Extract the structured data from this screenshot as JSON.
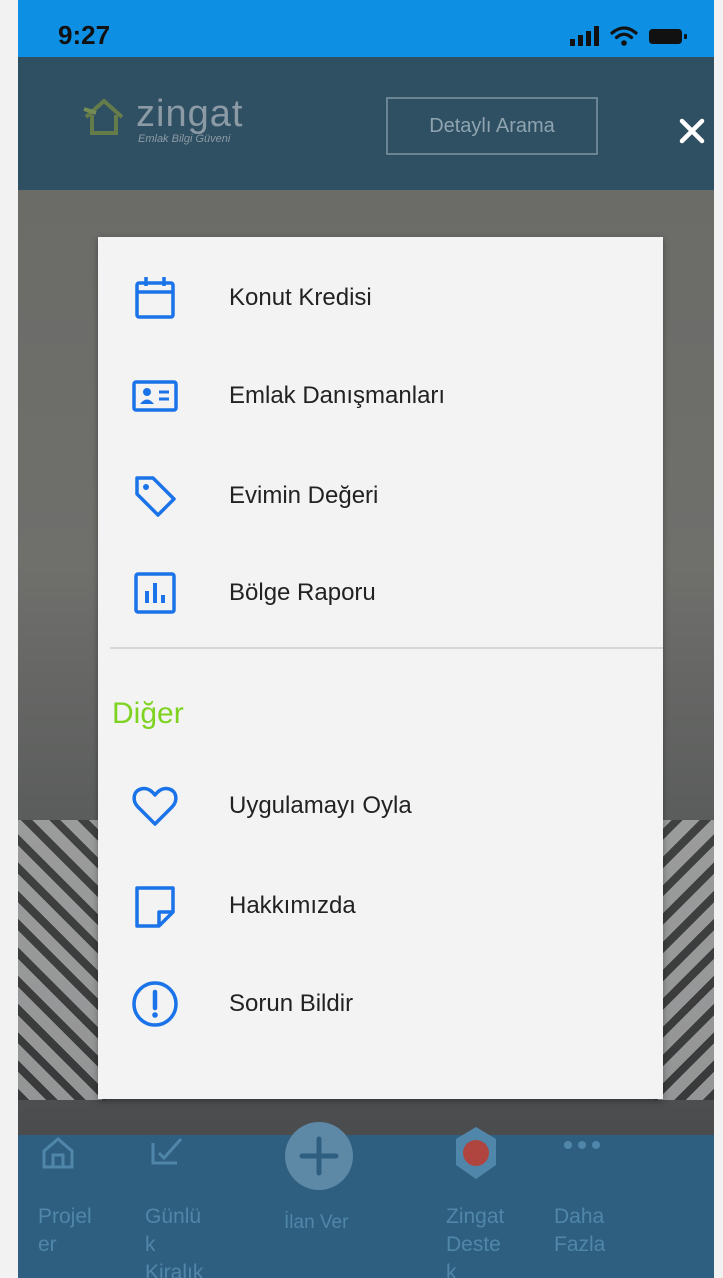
{
  "status_bar": {
    "time": "9:27"
  },
  "header": {
    "logo_text": "zingat",
    "logo_tagline": "Emlak Bilgi Güveni",
    "search_button": "Detaylı Arama"
  },
  "menu": {
    "items": [
      {
        "label": "Konut Kredisi",
        "icon": "calendar-icon"
      },
      {
        "label": "Emlak Danışmanları",
        "icon": "id-card-icon"
      },
      {
        "label": "Evimin Değeri",
        "icon": "tag-icon"
      },
      {
        "label": "Bölge Raporu",
        "icon": "bar-chart-icon"
      }
    ],
    "section_title": "Diğer",
    "other_items": [
      {
        "label": "Uygulamayı Oyla",
        "icon": "heart-icon"
      },
      {
        "label": "Hakkımızda",
        "icon": "note-icon"
      },
      {
        "label": "Sorun Bildir",
        "icon": "alert-circle-icon"
      }
    ]
  },
  "tab_bar": {
    "tabs": [
      {
        "label_lines": [
          "Projel",
          "er"
        ],
        "icon": "home-icon"
      },
      {
        "label_lines": [
          "Günlü",
          "k",
          "Kiralık"
        ],
        "icon": "calendar-check-icon"
      },
      {
        "label_lines": [
          "İlan Ver"
        ],
        "icon": "plus-icon"
      },
      {
        "label_lines": [
          "Zingat",
          "Deste",
          "k"
        ],
        "icon": "support-badge-icon"
      },
      {
        "label_lines": [
          "Daha",
          "Fazla"
        ],
        "icon": "more-icon"
      }
    ]
  },
  "colors": {
    "accent_blue": "#1a73e8",
    "section_green": "#7ed321",
    "status_bar": "#0d8fe3",
    "header": "#2f4f63"
  }
}
